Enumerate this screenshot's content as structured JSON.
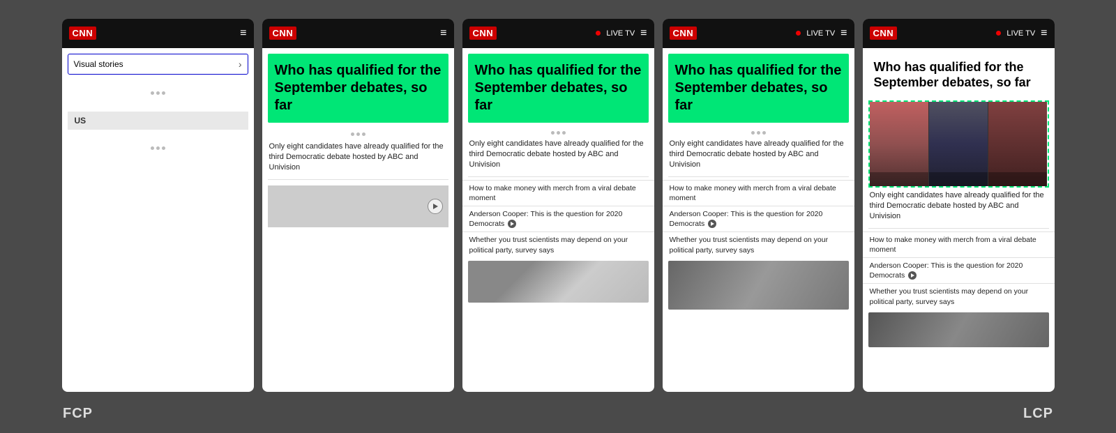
{
  "background_color": "#4a4a4a",
  "labels": {
    "fcp": "FCP",
    "lcp": "LCP"
  },
  "phones": [
    {
      "id": "phone1",
      "type": "fcp_first",
      "has_live_tv": false,
      "show_visual_stories": true,
      "show_title": false,
      "show_people_image": false,
      "show_us_section": true,
      "show_loading_dots": true
    },
    {
      "id": "phone2",
      "type": "middle1",
      "has_live_tv": false,
      "show_visual_stories": false,
      "show_title": true,
      "show_people_image": false,
      "show_video_area": true
    },
    {
      "id": "phone3",
      "type": "middle2",
      "has_live_tv": true,
      "show_visual_stories": false,
      "show_title": true,
      "show_people_image": false,
      "show_bottom_image": true,
      "bottom_image_type": "partial"
    },
    {
      "id": "phone4",
      "type": "middle3",
      "has_live_tv": true,
      "show_visual_stories": false,
      "show_title": true,
      "show_people_image": false,
      "show_bottom_image": true,
      "bottom_image_type": "full"
    },
    {
      "id": "phone5",
      "type": "lcp_last",
      "has_live_tv": true,
      "show_visual_stories": false,
      "show_title": true,
      "show_people_image": true,
      "show_bottom_image": true
    }
  ],
  "headline": {
    "title": "Who has qualified for the September debates, so far",
    "article_text": "Only eight candidates have already qualified for the third Democratic debate hosted by ABC and Univision",
    "sub_articles": [
      "How to make money with merch from a viral debate moment",
      "Anderson Cooper: This is the question for 2020 Democrats",
      "Whether you trust scientists may depend on your political party, survey says"
    ]
  },
  "ui": {
    "cnn_label": "CNN",
    "live_tv_label": "LIVE TV",
    "visual_stories_label": "Visual stories",
    "us_section_label": "US",
    "loading_dots_count": 3,
    "hamburger_icon": "≡",
    "arrow_right": "›"
  }
}
